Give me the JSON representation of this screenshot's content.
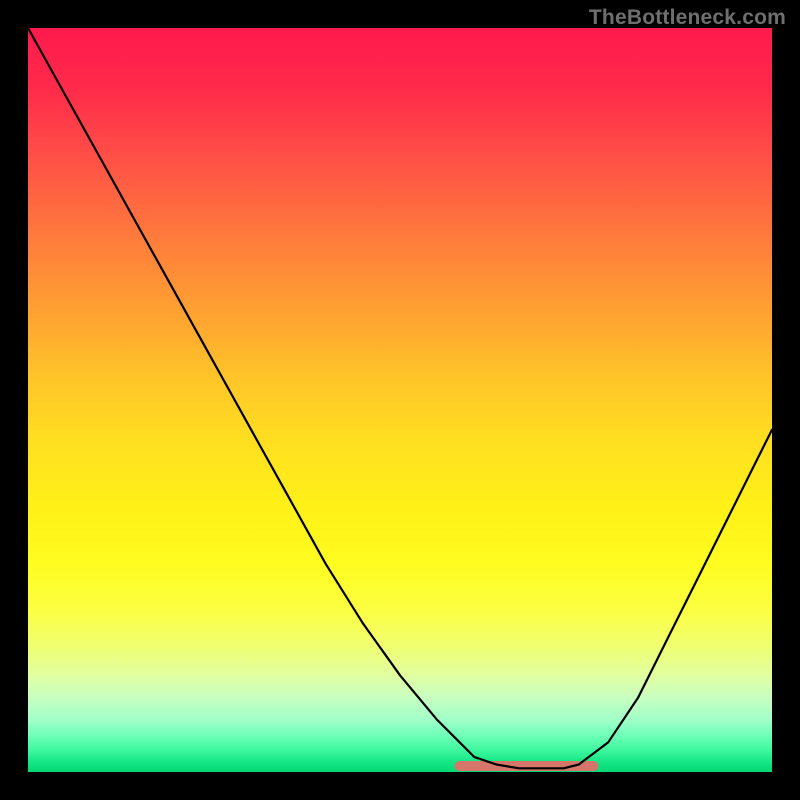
{
  "watermark": "TheBottleneck.com",
  "chart_data": {
    "type": "line",
    "title": "",
    "xlabel": "",
    "ylabel": "",
    "xlim": [
      0,
      100
    ],
    "ylim": [
      0,
      100
    ],
    "grid": false,
    "legend": false,
    "background_gradient": {
      "top": "#ff1a4d",
      "mid": "#fff018",
      "bottom": "#00d870"
    },
    "series": [
      {
        "name": "bottleneck-curve",
        "color": "#000000",
        "x": [
          0,
          5,
          10,
          15,
          20,
          25,
          30,
          35,
          40,
          45,
          50,
          55,
          58,
          60,
          63,
          66,
          70,
          72,
          74,
          78,
          82,
          86,
          90,
          94,
          98,
          100
        ],
        "y": [
          100,
          91,
          82,
          73,
          64,
          55,
          46,
          37,
          28,
          20,
          13,
          7,
          4,
          2,
          1,
          0.5,
          0.5,
          0.5,
          1,
          4,
          10,
          18,
          26,
          34,
          42,
          46
        ]
      }
    ],
    "accent_segment": {
      "name": "flat-min-highlight",
      "color": "#d6766b",
      "x_start": 58,
      "x_end": 76,
      "y": 0.8
    }
  }
}
